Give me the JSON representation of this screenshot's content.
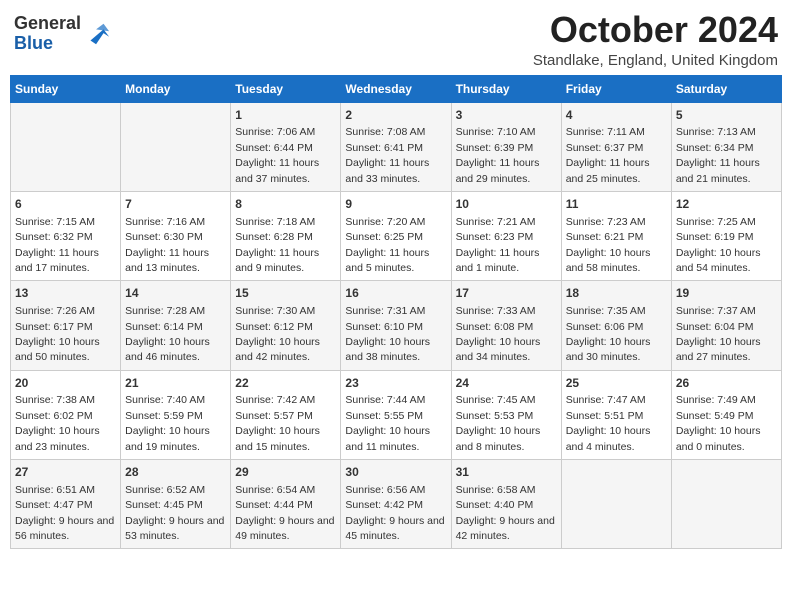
{
  "header": {
    "logo_general": "General",
    "logo_blue": "Blue",
    "month_title": "October 2024",
    "location": "Standlake, England, United Kingdom"
  },
  "days_of_week": [
    "Sunday",
    "Monday",
    "Tuesday",
    "Wednesday",
    "Thursday",
    "Friday",
    "Saturday"
  ],
  "weeks": [
    [
      {
        "day": "",
        "info": ""
      },
      {
        "day": "",
        "info": ""
      },
      {
        "day": "1",
        "info": "Sunrise: 7:06 AM\nSunset: 6:44 PM\nDaylight: 11 hours and 37 minutes."
      },
      {
        "day": "2",
        "info": "Sunrise: 7:08 AM\nSunset: 6:41 PM\nDaylight: 11 hours and 33 minutes."
      },
      {
        "day": "3",
        "info": "Sunrise: 7:10 AM\nSunset: 6:39 PM\nDaylight: 11 hours and 29 minutes."
      },
      {
        "day": "4",
        "info": "Sunrise: 7:11 AM\nSunset: 6:37 PM\nDaylight: 11 hours and 25 minutes."
      },
      {
        "day": "5",
        "info": "Sunrise: 7:13 AM\nSunset: 6:34 PM\nDaylight: 11 hours and 21 minutes."
      }
    ],
    [
      {
        "day": "6",
        "info": "Sunrise: 7:15 AM\nSunset: 6:32 PM\nDaylight: 11 hours and 17 minutes."
      },
      {
        "day": "7",
        "info": "Sunrise: 7:16 AM\nSunset: 6:30 PM\nDaylight: 11 hours and 13 minutes."
      },
      {
        "day": "8",
        "info": "Sunrise: 7:18 AM\nSunset: 6:28 PM\nDaylight: 11 hours and 9 minutes."
      },
      {
        "day": "9",
        "info": "Sunrise: 7:20 AM\nSunset: 6:25 PM\nDaylight: 11 hours and 5 minutes."
      },
      {
        "day": "10",
        "info": "Sunrise: 7:21 AM\nSunset: 6:23 PM\nDaylight: 11 hours and 1 minute."
      },
      {
        "day": "11",
        "info": "Sunrise: 7:23 AM\nSunset: 6:21 PM\nDaylight: 10 hours and 58 minutes."
      },
      {
        "day": "12",
        "info": "Sunrise: 7:25 AM\nSunset: 6:19 PM\nDaylight: 10 hours and 54 minutes."
      }
    ],
    [
      {
        "day": "13",
        "info": "Sunrise: 7:26 AM\nSunset: 6:17 PM\nDaylight: 10 hours and 50 minutes."
      },
      {
        "day": "14",
        "info": "Sunrise: 7:28 AM\nSunset: 6:14 PM\nDaylight: 10 hours and 46 minutes."
      },
      {
        "day": "15",
        "info": "Sunrise: 7:30 AM\nSunset: 6:12 PM\nDaylight: 10 hours and 42 minutes."
      },
      {
        "day": "16",
        "info": "Sunrise: 7:31 AM\nSunset: 6:10 PM\nDaylight: 10 hours and 38 minutes."
      },
      {
        "day": "17",
        "info": "Sunrise: 7:33 AM\nSunset: 6:08 PM\nDaylight: 10 hours and 34 minutes."
      },
      {
        "day": "18",
        "info": "Sunrise: 7:35 AM\nSunset: 6:06 PM\nDaylight: 10 hours and 30 minutes."
      },
      {
        "day": "19",
        "info": "Sunrise: 7:37 AM\nSunset: 6:04 PM\nDaylight: 10 hours and 27 minutes."
      }
    ],
    [
      {
        "day": "20",
        "info": "Sunrise: 7:38 AM\nSunset: 6:02 PM\nDaylight: 10 hours and 23 minutes."
      },
      {
        "day": "21",
        "info": "Sunrise: 7:40 AM\nSunset: 5:59 PM\nDaylight: 10 hours and 19 minutes."
      },
      {
        "day": "22",
        "info": "Sunrise: 7:42 AM\nSunset: 5:57 PM\nDaylight: 10 hours and 15 minutes."
      },
      {
        "day": "23",
        "info": "Sunrise: 7:44 AM\nSunset: 5:55 PM\nDaylight: 10 hours and 11 minutes."
      },
      {
        "day": "24",
        "info": "Sunrise: 7:45 AM\nSunset: 5:53 PM\nDaylight: 10 hours and 8 minutes."
      },
      {
        "day": "25",
        "info": "Sunrise: 7:47 AM\nSunset: 5:51 PM\nDaylight: 10 hours and 4 minutes."
      },
      {
        "day": "26",
        "info": "Sunrise: 7:49 AM\nSunset: 5:49 PM\nDaylight: 10 hours and 0 minutes."
      }
    ],
    [
      {
        "day": "27",
        "info": "Sunrise: 6:51 AM\nSunset: 4:47 PM\nDaylight: 9 hours and 56 minutes."
      },
      {
        "day": "28",
        "info": "Sunrise: 6:52 AM\nSunset: 4:45 PM\nDaylight: 9 hours and 53 minutes."
      },
      {
        "day": "29",
        "info": "Sunrise: 6:54 AM\nSunset: 4:44 PM\nDaylight: 9 hours and 49 minutes."
      },
      {
        "day": "30",
        "info": "Sunrise: 6:56 AM\nSunset: 4:42 PM\nDaylight: 9 hours and 45 minutes."
      },
      {
        "day": "31",
        "info": "Sunrise: 6:58 AM\nSunset: 4:40 PM\nDaylight: 9 hours and 42 minutes."
      },
      {
        "day": "",
        "info": ""
      },
      {
        "day": "",
        "info": ""
      }
    ]
  ]
}
